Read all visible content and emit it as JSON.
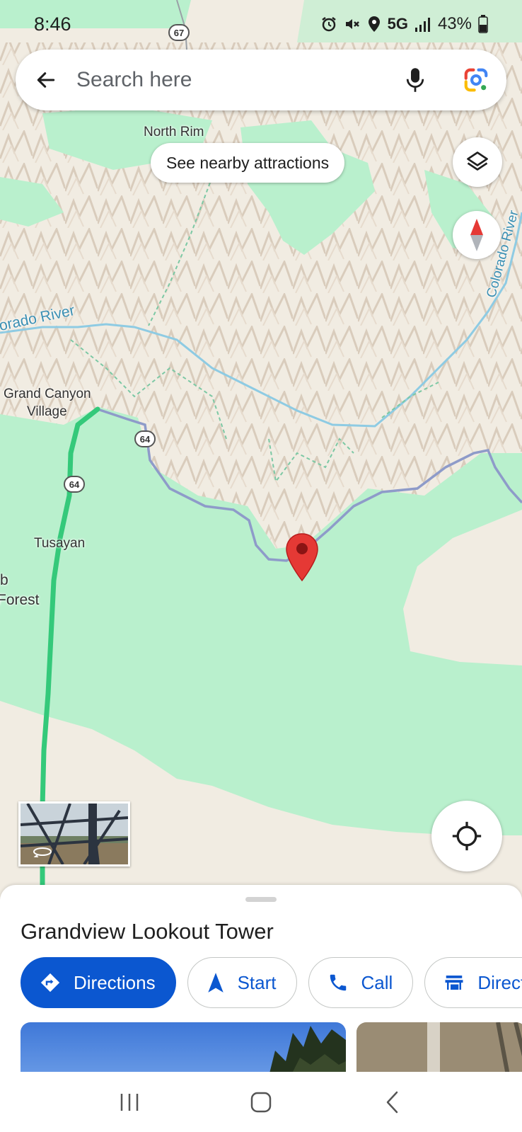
{
  "status_bar": {
    "time": "8:46",
    "network": "5G",
    "battery": "43%",
    "icons": [
      "alarm-icon",
      "mute-icon",
      "location-icon",
      "signal-icon",
      "battery-icon"
    ]
  },
  "search": {
    "placeholder": "Search here",
    "icons": [
      "back-arrow-icon",
      "microphone-icon",
      "google-lens-icon"
    ]
  },
  "map": {
    "nearby_chip": "See nearby attractions",
    "labels": {
      "north_rim": "North Rim",
      "colorado_river_left": "orado River",
      "colorado_river_right": "Colorado River",
      "grand_canyon_village_1": "Grand Canyon",
      "grand_canyon_village_2": "Village",
      "tusayan": "Tusayan",
      "forest_1": "b",
      "forest_2": "Forest"
    },
    "road_shields": {
      "top": "67",
      "road_64_east": "64",
      "road_64_south": "64"
    },
    "controls": [
      "layers-icon",
      "compass-icon",
      "my-location-icon"
    ],
    "street_view_icon": "street-view-360-icon",
    "colors": {
      "forest": "#b9f0cd",
      "terrain": "#f1ece2",
      "water": "#8ecbe3",
      "route": "#34c97a",
      "pin": "#e53935"
    }
  },
  "place": {
    "name": "Grandview Lookout Tower",
    "actions": [
      {
        "label": "Directions",
        "icon": "directions-icon",
        "primary": true
      },
      {
        "label": "Start",
        "icon": "navigation-arrow-icon",
        "primary": false
      },
      {
        "label": "Call",
        "icon": "phone-icon",
        "primary": false
      },
      {
        "label": "Directo",
        "icon": "directory-store-icon",
        "primary": false
      }
    ]
  },
  "nav_bar": {
    "icons": [
      "recent-apps-icon",
      "home-icon",
      "back-icon"
    ]
  },
  "colors": {
    "accent": "#0b57d0",
    "text": "#1f1f1f",
    "subtle": "#5f6368"
  }
}
